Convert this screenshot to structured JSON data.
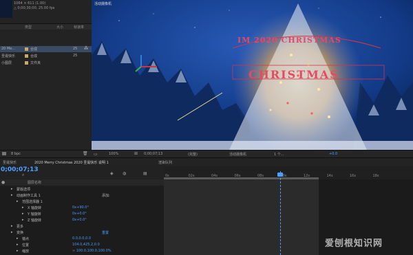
{
  "project": {
    "info_line1": "1064 × 611 (1.00)",
    "info_line2": "△ 0;00;30;00, 25.00 fps",
    "headers": {
      "name": "",
      "type": "类型",
      "size": "大小",
      "frame_rate": "帧速率"
    },
    "items": [
      {
        "name": "20 Me...",
        "type": "合成",
        "rate": "25",
        "color": "#c9a96a",
        "selected": true
      },
      {
        "name": "圣诞快乐",
        "type": "合成",
        "rate": "25",
        "color": "#c9a96a",
        "selected": false
      },
      {
        "name": "小图层",
        "type": "文件夹",
        "rate": "",
        "color": "#c9a96a",
        "selected": false
      }
    ],
    "footer_bpc": "8 bpc"
  },
  "viewer": {
    "tab_label": "活动摄像机",
    "zoom": "100%",
    "timecode": "0;00;07;13",
    "view_mode": "(完整)",
    "camera": "活动摄像机",
    "views": "1 个...",
    "offset": "+0.0"
  },
  "timeline": {
    "tabs": [
      "圣诞快乐",
      "2020 Merry Christmas 2020 圣诞快乐 说明 1",
      "渲染队列"
    ],
    "timecode": "0;00;07;13",
    "layer_header": "图层名称",
    "ruler_labels": [
      "0s",
      "02s",
      "04s",
      "06s",
      "08s",
      "10s",
      "12s",
      "14s",
      "16s",
      "18s"
    ],
    "rows": [
      {
        "indent": 1,
        "label": "蒙版选项",
        "value": ""
      },
      {
        "indent": 1,
        "label": "动画制作工具 1",
        "value": "",
        "extra": "添加:"
      },
      {
        "indent": 2,
        "label": "范围选择器 1",
        "value": ""
      },
      {
        "indent": 3,
        "label": "X 轴旋转",
        "value": "0x+90.0°"
      },
      {
        "indent": 3,
        "label": "Y 轴旋转",
        "value": "0x+0.0°"
      },
      {
        "indent": 3,
        "label": "Z 轴旋转",
        "value": "0x+0.0°"
      },
      {
        "indent": 1,
        "label": "更多",
        "value": ""
      },
      {
        "indent": 1,
        "label": "变换",
        "value": "",
        "extra": "重置"
      },
      {
        "indent": 2,
        "label": "锚点",
        "value": "0.0,0.0,0.0"
      },
      {
        "indent": 2,
        "label": "位置",
        "value": "104.0,425.2,0.0"
      },
      {
        "indent": 2,
        "label": "缩放",
        "value": "∞ 100.0,100.0,100.0%"
      }
    ]
  },
  "watermark": "爱刨根知识网",
  "colors": {
    "accent": "#4aa0ff",
    "selection": "#3b4a63"
  }
}
